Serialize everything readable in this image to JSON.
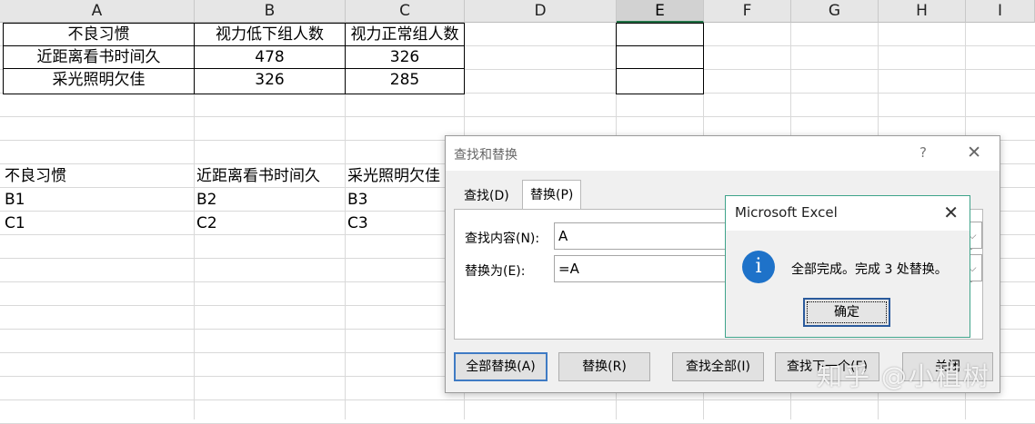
{
  "columns": [
    "A",
    "B",
    "C",
    "D",
    "E",
    "F",
    "G",
    "H",
    "I"
  ],
  "selected_column": "E",
  "table1": {
    "headers": [
      "不良习惯",
      "视力低下组人数",
      "视力正常组人数"
    ],
    "rows": [
      [
        "近距离看书时间久",
        "478",
        "326"
      ],
      [
        "采光照明欠佳",
        "326",
        "285"
      ]
    ]
  },
  "table2": {
    "headers": [
      "不良习惯",
      "近距离看书时间久",
      "采光照明欠佳"
    ],
    "rows": [
      [
        "B1",
        "B2",
        "B3"
      ],
      [
        "C1",
        "C2",
        "C3"
      ]
    ]
  },
  "find_replace": {
    "title": "查找和替换",
    "help": "?",
    "close": "✕",
    "tabs": [
      "查找(D)",
      "替换(P)"
    ],
    "find_label": "查找内容(N):",
    "find_value": "A",
    "replace_label": "替换为(E):",
    "replace_value": "=A",
    "buttons": {
      "replace_all": "全部替换(A)",
      "replace": "替换(R)",
      "find_all": "查找全部(I)",
      "find_next": "查找下一个(F)",
      "close": "关闭"
    }
  },
  "message_box": {
    "title": "Microsoft Excel",
    "close": "✕",
    "icon": "i",
    "text": "全部完成。完成 3 处替换。",
    "ok": "确定"
  },
  "watermark": "知乎 @小植树"
}
